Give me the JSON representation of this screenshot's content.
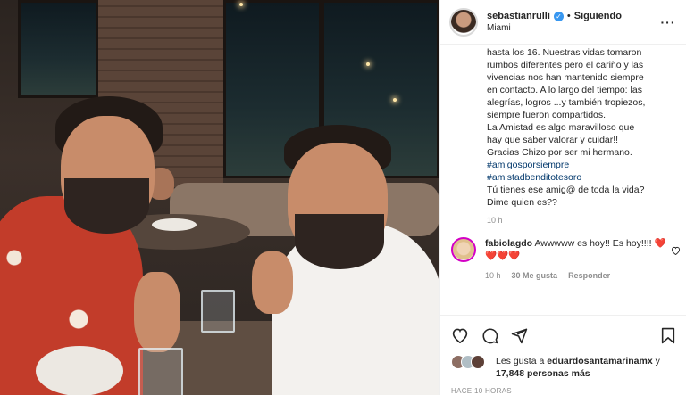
{
  "header": {
    "username": "sebastianrulli",
    "verified_icon": "verified-badge-icon",
    "separator": "•",
    "follow_label": "Siguiendo",
    "location": "Miami",
    "more_icon": "more-options-icon"
  },
  "caption": {
    "lines": [
      "hasta los 16. Nuestras vidas tomaron",
      "rumbos diferentes pero el cariño y las",
      "vivencias nos han mantenido siempre",
      "en contacto. A lo largo del tiempo: las",
      "alegrías, logros ...y también tropiezos,",
      "siempre fueron compartidos.",
      "La Amistad es algo maravilloso que",
      "hay que saber valorar y cuidar!!",
      "Gracias Chizo por ser mi hermano."
    ],
    "hashtags": [
      "#amigosporsiempre",
      "#amistadbenditotesoro"
    ],
    "closing": [
      "Tú tienes ese amig@ de toda la vida?",
      "Dime quien es??"
    ],
    "time": "10 h"
  },
  "comment": {
    "username": "fabiolagdo",
    "text": "Awwwww es hoy!! Es hoy!!!!",
    "hearts": "❤️❤️❤️❤️",
    "time": "10 h",
    "likes": "30 Me gusta",
    "reply": "Responder",
    "like_icon": "heart-outline-icon"
  },
  "actions": {
    "icons": [
      "heart-icon",
      "comment-icon",
      "share-icon",
      "bookmark-icon"
    ]
  },
  "likes": {
    "prefix": "Les gusta a",
    "user": "eduardosantamarinamx",
    "conj": "y",
    "count": "17,848 personas más"
  },
  "posted": "HACE 10 HORAS",
  "colors": {
    "accent_blue": "#3897f0",
    "hashtag": "#00376b",
    "heart_red": "#ed4956"
  }
}
